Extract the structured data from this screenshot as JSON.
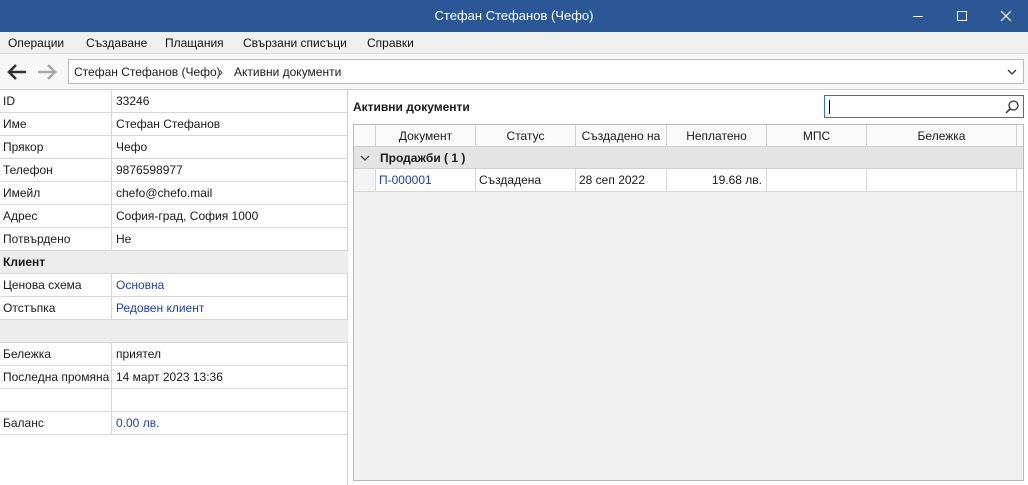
{
  "window": {
    "title": "Стефан Стефанов (Чефо)"
  },
  "menu": [
    "Операции",
    "Създаване",
    "Плащания",
    "Свързани списъци",
    "Справки"
  ],
  "breadcrumb": {
    "client": "Стефан Стефанов (Чефо)",
    "separator": "›",
    "page": "Активни документи"
  },
  "properties": {
    "id": {
      "label": "ID",
      "value": "33246"
    },
    "name": {
      "label": "Име",
      "value": "Стефан Стефанов"
    },
    "nickname": {
      "label": "Прякор",
      "value": "Чефо"
    },
    "phone": {
      "label": "Телефон",
      "value": "9876598977"
    },
    "email": {
      "label": "Имейл",
      "value": "chefo@chefo.mail"
    },
    "address": {
      "label": "Адрес",
      "value": "София-град, София 1000"
    },
    "confirmed": {
      "label": "Потвърдено",
      "value": "Не"
    },
    "client_section": "Клиент",
    "price_scheme": {
      "label": "Ценова схема",
      "value": "Основна"
    },
    "discount": {
      "label": "Отстъпка",
      "value": "Редовен клиент"
    },
    "note": {
      "label": "Бележка",
      "value": "приятел"
    },
    "last_change": {
      "label": "Последна промяна",
      "value": "14 март 2023 13:36"
    },
    "balance": {
      "label": "Баланс",
      "value": "0.00 лв."
    }
  },
  "documents": {
    "title": "Активни документи",
    "search": {
      "value": ""
    },
    "columns": [
      "Документ",
      "Статус",
      "Създадено на",
      "Неплатено",
      "МПС",
      "Бележка"
    ],
    "group": {
      "label": "Продажби ( 1 )"
    },
    "rows": [
      {
        "document": "П-000001",
        "status": "Създадена",
        "created": "28 сеп 2022",
        "unpaid": "19.68 лв.",
        "vehicle": "",
        "note": ""
      }
    ]
  },
  "colors": {
    "titlebar": "#2b5797",
    "link": "#1f3fb0",
    "search_border": "#3574c4"
  },
  "icons": [
    "minimize-icon",
    "maximize-icon",
    "close-icon",
    "back-arrow-icon",
    "forward-arrow-icon",
    "chevron-down-icon",
    "search-icon",
    "collapse-chevron-icon"
  ]
}
